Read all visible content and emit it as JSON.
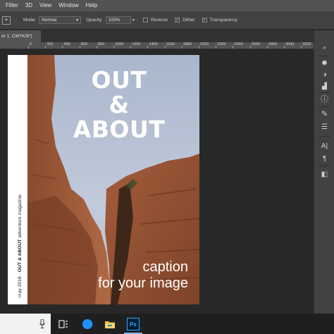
{
  "menubar": {
    "items": [
      "Filter",
      "3D",
      "View",
      "Window",
      "Help"
    ]
  },
  "options": {
    "mode_label": "Mode:",
    "mode_value": "Normal",
    "opacity_label": "Opacity:",
    "opacity_value": "100%",
    "reverse_label": "Reverse",
    "reverse_checked": false,
    "dither_label": "Dither",
    "dither_checked": true,
    "transparency_label": "Transparency",
    "transparency_checked": true
  },
  "document": {
    "tab_label": "er 1, CMYK/8*)"
  },
  "ruler": {
    "ticks": [
      "0",
      "200",
      "400",
      "600",
      "800",
      "1000",
      "1200",
      "1400",
      "1600",
      "1800",
      "2000",
      "2200",
      "2400",
      "2600",
      "2800",
      "3000",
      "3200",
      "3400"
    ]
  },
  "cover": {
    "title_line1": "OUT",
    "title_line2": "&",
    "title_line3": "ABOUT",
    "caption_line1": "caption",
    "caption_line2": "for your image",
    "spine_date": "may 2018 · ",
    "spine_brand": "OUT & ABOUT",
    "spine_tagline": " adventure magazine"
  },
  "right_panel": {
    "icons": [
      "collapse-arrows-icon",
      "brushes-icon",
      "adjust-icon",
      "histogram-icon",
      "info-icon",
      "brush-presets-icon",
      "properties-icon",
      "character-icon",
      "paragraph-icon",
      "layers-icon"
    ]
  },
  "taskbar": {
    "apps": [
      "microphone-icon",
      "task-view-icon",
      "edge-icon",
      "file-explorer-icon",
      "photoshop-icon"
    ],
    "photoshop_label": "Ps"
  },
  "colors": {
    "ui_dark": "#282828",
    "ui_panel": "#424242",
    "menubar": "#535353",
    "edge_blue": "#1e90ff",
    "ps_blue": "#31a8ff",
    "explorer_yellow": "#f0c040"
  }
}
